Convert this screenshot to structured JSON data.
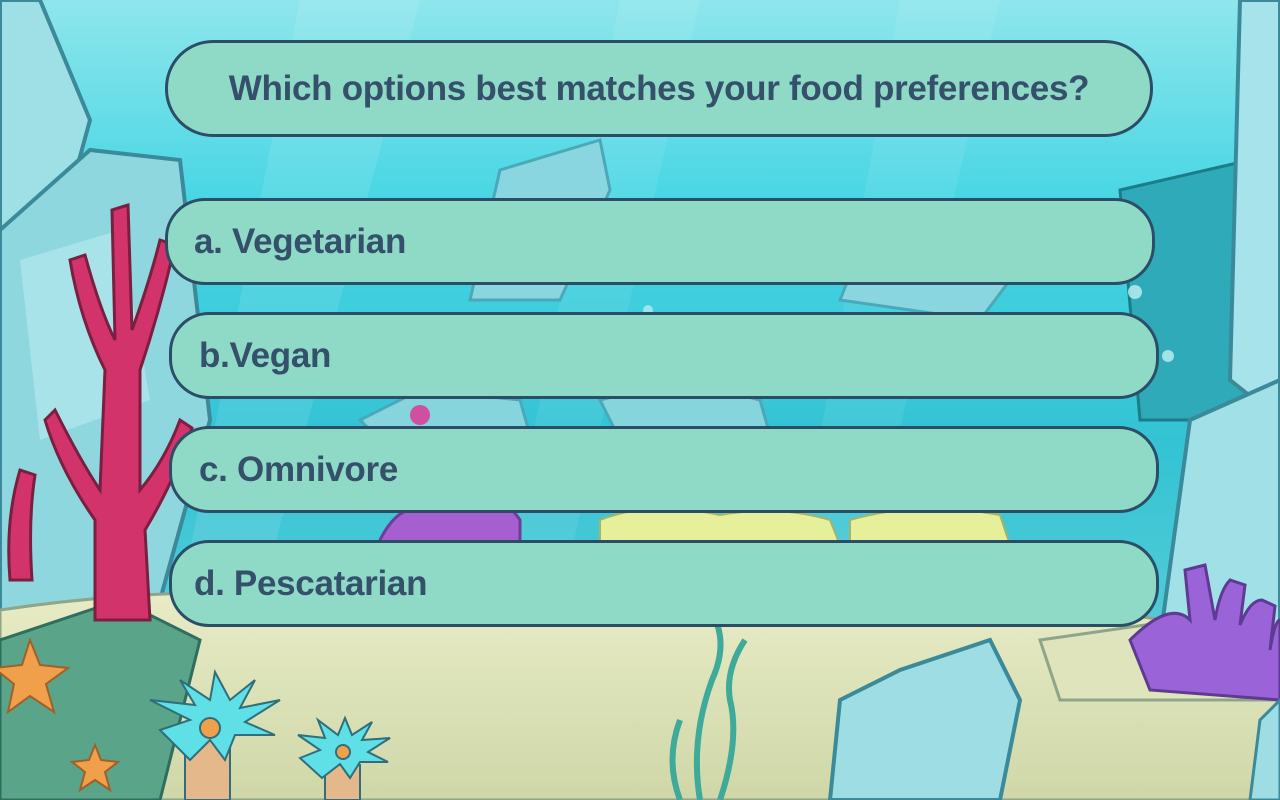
{
  "question": {
    "text": "Which options best matches your food preferences?"
  },
  "options": [
    {
      "label": "a. Vegetarian"
    },
    {
      "label": "b.Vegan"
    },
    {
      "label": "c. Omnivore"
    },
    {
      "label": "d. Pescatarian"
    }
  ],
  "colors": {
    "box_fill": "#8fd9c7",
    "box_border": "#2c4d66",
    "text": "#34506b",
    "water": "#5fd6e0",
    "sand": "#dfe3b8",
    "coral_red": "#d2336b",
    "coral_purple": "#9b5fd6"
  },
  "scene": {
    "theme": "underwater-reef"
  }
}
